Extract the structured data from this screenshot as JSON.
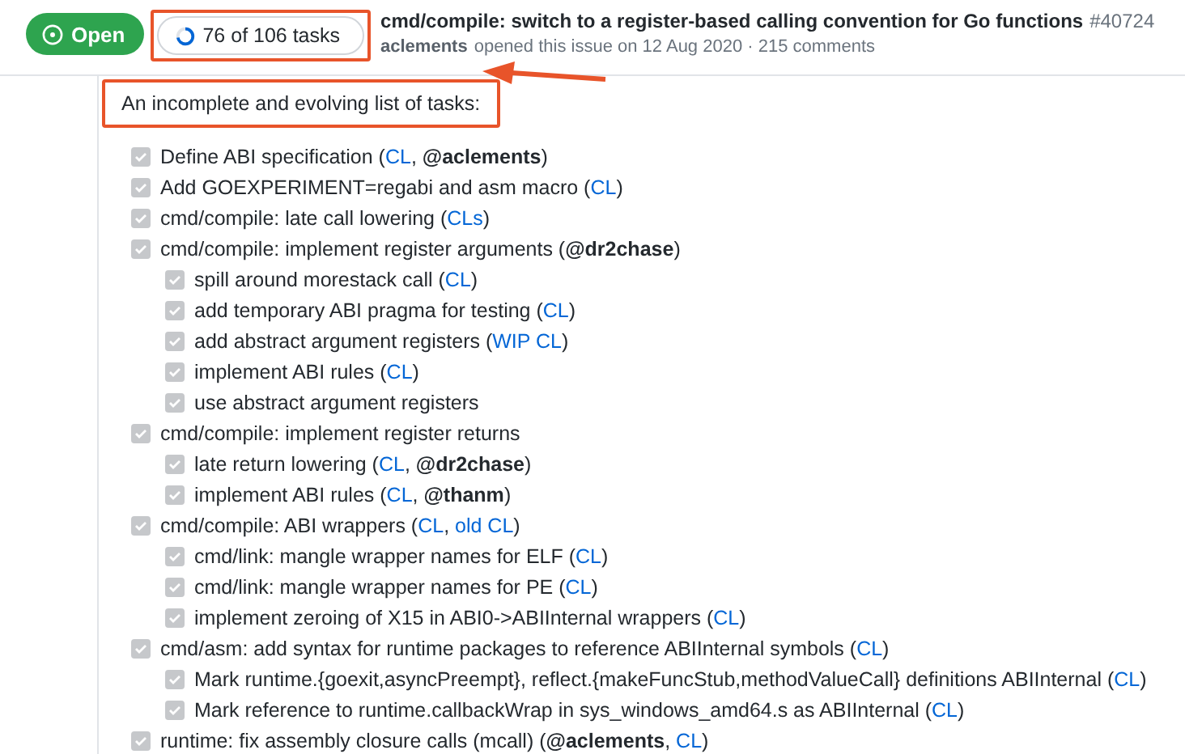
{
  "issue": {
    "state": "Open",
    "open": true,
    "tasks_summary": "76 of 106 tasks",
    "title": "cmd/compile: switch to a register-based calling convention for Go functions",
    "number": "#40724",
    "author": "aclements",
    "meta": "opened this issue on 12 Aug 2020 · 215 comments"
  },
  "intro": "An incomplete and evolving list of tasks:",
  "tasks": [
    {
      "checked": true,
      "parts": [
        {
          "kind": "text",
          "text": "Define ABI specification ("
        },
        {
          "kind": "link",
          "text": "CL"
        },
        {
          "kind": "text",
          "text": ", "
        },
        {
          "kind": "mention",
          "text": "@aclements"
        },
        {
          "kind": "text",
          "text": ")"
        }
      ]
    },
    {
      "checked": true,
      "parts": [
        {
          "kind": "text",
          "text": "Add GOEXPERIMENT=regabi and asm macro ("
        },
        {
          "kind": "link",
          "text": "CL"
        },
        {
          "kind": "text",
          "text": ")"
        }
      ]
    },
    {
      "checked": true,
      "parts": [
        {
          "kind": "text",
          "text": "cmd/compile: late call lowering ("
        },
        {
          "kind": "link",
          "text": "CLs"
        },
        {
          "kind": "text",
          "text": ")"
        }
      ]
    },
    {
      "checked": true,
      "parts": [
        {
          "kind": "text",
          "text": "cmd/compile: implement register arguments ("
        },
        {
          "kind": "mention",
          "text": "@dr2chase"
        },
        {
          "kind": "text",
          "text": ")"
        }
      ],
      "children": [
        {
          "checked": true,
          "parts": [
            {
              "kind": "text",
              "text": "spill around morestack call ("
            },
            {
              "kind": "link",
              "text": "CL"
            },
            {
              "kind": "text",
              "text": ")"
            }
          ]
        },
        {
          "checked": true,
          "parts": [
            {
              "kind": "text",
              "text": "add temporary ABI pragma for testing ("
            },
            {
              "kind": "link",
              "text": "CL"
            },
            {
              "kind": "text",
              "text": ")"
            }
          ]
        },
        {
          "checked": true,
          "parts": [
            {
              "kind": "text",
              "text": "add abstract argument registers ("
            },
            {
              "kind": "link",
              "text": "WIP CL"
            },
            {
              "kind": "text",
              "text": ")"
            }
          ]
        },
        {
          "checked": true,
          "parts": [
            {
              "kind": "text",
              "text": "implement ABI rules ("
            },
            {
              "kind": "link",
              "text": "CL"
            },
            {
              "kind": "text",
              "text": ")"
            }
          ]
        },
        {
          "checked": true,
          "parts": [
            {
              "kind": "text",
              "text": "use abstract argument registers"
            }
          ]
        }
      ]
    },
    {
      "checked": true,
      "parts": [
        {
          "kind": "text",
          "text": "cmd/compile: implement register returns"
        }
      ],
      "children": [
        {
          "checked": true,
          "parts": [
            {
              "kind": "text",
              "text": "late return lowering ("
            },
            {
              "kind": "link",
              "text": "CL"
            },
            {
              "kind": "text",
              "text": ", "
            },
            {
              "kind": "mention",
              "text": "@dr2chase"
            },
            {
              "kind": "text",
              "text": ")"
            }
          ]
        },
        {
          "checked": true,
          "parts": [
            {
              "kind": "text",
              "text": "implement ABI rules ("
            },
            {
              "kind": "link",
              "text": "CL"
            },
            {
              "kind": "text",
              "text": ", "
            },
            {
              "kind": "mention",
              "text": "@thanm"
            },
            {
              "kind": "text",
              "text": ")"
            }
          ]
        }
      ]
    },
    {
      "checked": true,
      "parts": [
        {
          "kind": "text",
          "text": "cmd/compile: ABI wrappers ("
        },
        {
          "kind": "link",
          "text": "CL"
        },
        {
          "kind": "text",
          "text": ", "
        },
        {
          "kind": "link",
          "text": "old CL"
        },
        {
          "kind": "text",
          "text": ")"
        }
      ],
      "children": [
        {
          "checked": true,
          "parts": [
            {
              "kind": "text",
              "text": "cmd/link: mangle wrapper names for ELF ("
            },
            {
              "kind": "link",
              "text": "CL"
            },
            {
              "kind": "text",
              "text": ")"
            }
          ]
        },
        {
          "checked": true,
          "parts": [
            {
              "kind": "text",
              "text": "cmd/link: mangle wrapper names for PE ("
            },
            {
              "kind": "link",
              "text": "CL"
            },
            {
              "kind": "text",
              "text": ")"
            }
          ]
        },
        {
          "checked": true,
          "parts": [
            {
              "kind": "text",
              "text": "implement zeroing of X15 in ABI0->ABIInternal wrappers ("
            },
            {
              "kind": "link",
              "text": "CL"
            },
            {
              "kind": "text",
              "text": ")"
            }
          ]
        }
      ]
    },
    {
      "checked": true,
      "parts": [
        {
          "kind": "text",
          "text": "cmd/asm: add syntax for runtime packages to reference ABIInternal symbols ("
        },
        {
          "kind": "link",
          "text": "CL"
        },
        {
          "kind": "text",
          "text": ")"
        }
      ],
      "children": [
        {
          "checked": true,
          "parts": [
            {
              "kind": "text",
              "text": "Mark runtime.{goexit,asyncPreempt}, reflect.{makeFuncStub,methodValueCall} definitions ABIInternal ("
            },
            {
              "kind": "link",
              "text": "CL"
            },
            {
              "kind": "text",
              "text": ")"
            }
          ]
        },
        {
          "checked": true,
          "parts": [
            {
              "kind": "text",
              "text": "Mark reference to runtime.callbackWrap in sys_windows_amd64.s as ABIInternal ("
            },
            {
              "kind": "link",
              "text": "CL"
            },
            {
              "kind": "text",
              "text": ")"
            }
          ]
        }
      ]
    },
    {
      "checked": true,
      "parts": [
        {
          "kind": "text",
          "text": "runtime: fix assembly closure calls (mcall) ("
        },
        {
          "kind": "mention",
          "text": "@aclements"
        },
        {
          "kind": "text",
          "text": ", "
        },
        {
          "kind": "link",
          "text": "CL"
        },
        {
          "kind": "text",
          "text": ")"
        }
      ]
    }
  ]
}
